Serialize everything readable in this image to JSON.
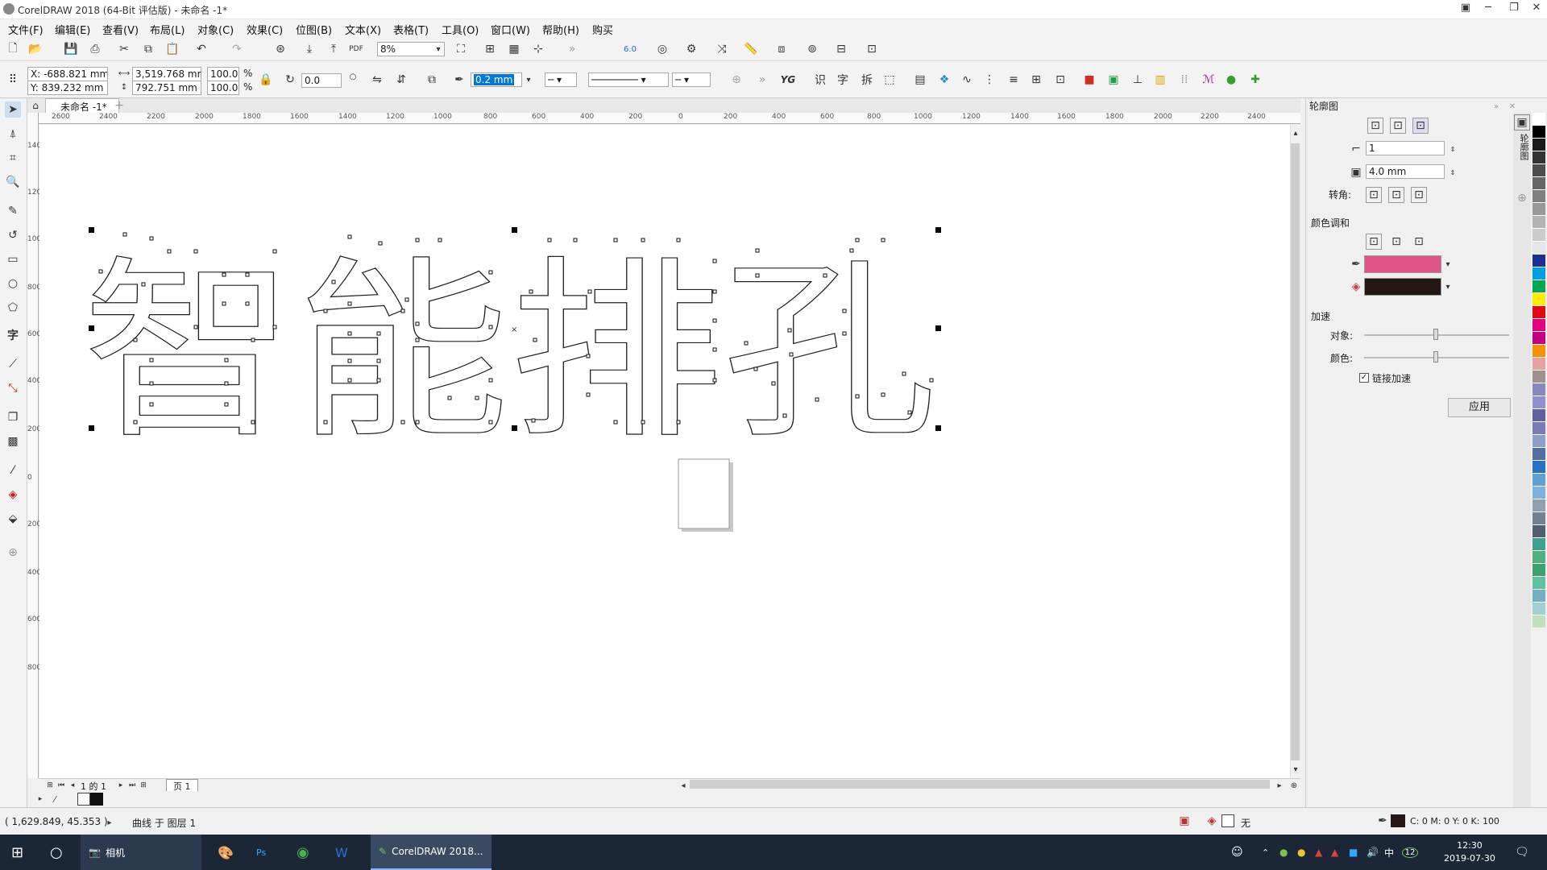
{
  "window": {
    "title": "CorelDRAW 2018 (64-Bit 评估版) - 未命名 -1*",
    "minimize": "─",
    "restore": "❐",
    "close": "✕"
  },
  "menu": [
    "文件(F)",
    "编辑(E)",
    "查看(V)",
    "布局(L)",
    "对象(C)",
    "效果(C)",
    "位图(B)",
    "文本(X)",
    "表格(T)",
    "工具(O)",
    "窗口(W)",
    "帮助(H)",
    "购买"
  ],
  "toolbar": {
    "zoom": "8%",
    "snap_value": "6.0"
  },
  "propbar": {
    "x": "X: -688.821 mm",
    "y": "Y: 839.232 mm",
    "width": "3,519.768 mm",
    "height": "792.751 mm",
    "scale_w": "100.0",
    "scale_h": "100.0",
    "pct": "%",
    "angle": "0.0",
    "outline_width": "0.2 mm",
    "text_tools": [
      "识",
      "字",
      "拆"
    ]
  },
  "doc": {
    "tab": "未命名 -1*",
    "add_tab": "+"
  },
  "ruler_h": [
    "2600",
    "2400",
    "2200",
    "2000",
    "1800",
    "1600",
    "1400",
    "1200",
    "1000",
    "800",
    "600",
    "400",
    "200",
    "0",
    "200",
    "400",
    "600",
    "800",
    "1000",
    "1200",
    "1400",
    "1600",
    "1800",
    "2000",
    "2200",
    "2400"
  ],
  "ruler_v": [
    "1400",
    "1200",
    "1000",
    "800",
    "600",
    "400",
    "200",
    "0",
    "200",
    "400",
    "600",
    "800"
  ],
  "canvas": {
    "text": "智能排孔"
  },
  "pagebar": {
    "page_indicator": "1 的 1",
    "page_tab": "页 1"
  },
  "docker": {
    "title": "轮廓图",
    "steps": "1",
    "offset": "4.0 mm",
    "corner_label": "转角:",
    "color_blend_label": "颜色调和",
    "outline_color": "#e05585",
    "fill_color": "#231815",
    "accel_label": "加速",
    "object_label": "对象:",
    "color_label": "颜色:",
    "link_accel": "链接加速",
    "apply": "应用",
    "side_tab": "轮廓图"
  },
  "palette": [
    "#ffffff",
    "#000000",
    "#1a1a1a",
    "#333333",
    "#4d4d4d",
    "#666666",
    "#808080",
    "#999999",
    "#b3b3b3",
    "#cccccc",
    "#e6e6e6",
    "#1e2f8f",
    "#009fe3",
    "#00a650",
    "#ffed00",
    "#e30613",
    "#e4007f",
    "#c40080",
    "#f29400",
    "#e8a0a0",
    "#a09090",
    "#8888c0",
    "#9090d0",
    "#6060a0",
    "#7a7ab8",
    "#8aa0c8",
    "#5070a0",
    "#2870c0",
    "#60a0d0",
    "#80b0e0",
    "#90a0b0",
    "#708090",
    "#506070",
    "#40a090",
    "#50b080",
    "#3ca070",
    "#60c0a0",
    "#70b0c0",
    "#a0d0d0",
    "#c0e0c0"
  ],
  "status": {
    "coords": "( 1,629.849, 45.353 )",
    "object": "曲线 于 图层 1",
    "fill_none": "无",
    "color_info": "C: 0 M: 0 Y: 0 K: 100"
  },
  "taskbar": {
    "camera": "相机",
    "corel": "CorelDRAW 2018...",
    "time": "12:30",
    "date": "2019-07-30",
    "ime": "中",
    "badge": "12"
  }
}
